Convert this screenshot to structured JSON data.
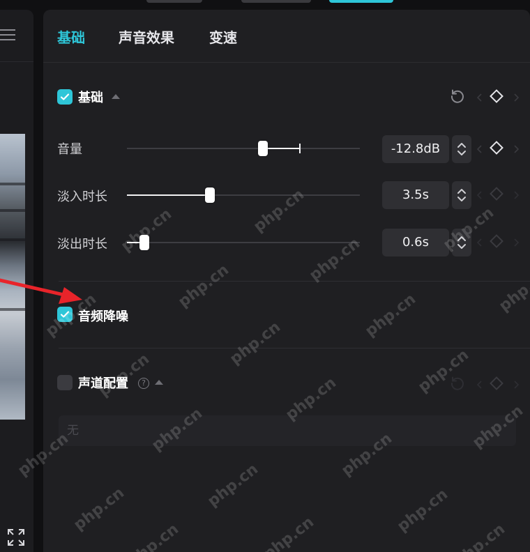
{
  "tabs": [
    {
      "label": "基础",
      "active": true
    },
    {
      "label": "声音效果",
      "active": false
    },
    {
      "label": "变速",
      "active": false
    }
  ],
  "basic_section": {
    "title": "基础",
    "checked": true,
    "rows": [
      {
        "label": "音量",
        "value": "-12.8dB",
        "slider_fraction": 0.585,
        "default_fraction": 0.74
      },
      {
        "label": "淡入时长",
        "value": "3.5s",
        "slider_fraction": 0.355
      },
      {
        "label": "淡出时长",
        "value": "0.6s",
        "slider_fraction": 0.075
      }
    ]
  },
  "noise_reduction": {
    "label": "音频降噪",
    "checked": true
  },
  "channel_section": {
    "title": "声道配置",
    "checked": false,
    "help_glyph": "?",
    "dropdown_value": "无"
  },
  "watermark_text": "php.cn",
  "colors": {
    "accent": "#2ec6d8",
    "panel_bg": "#1f1f22",
    "annotation_arrow": "#e8242a"
  },
  "icons": [
    "menu-icon",
    "fullscreen-icon",
    "reset-icon",
    "keyframe-diamond-icon",
    "chevron-up-down-icon",
    "check-icon",
    "help-icon"
  ]
}
